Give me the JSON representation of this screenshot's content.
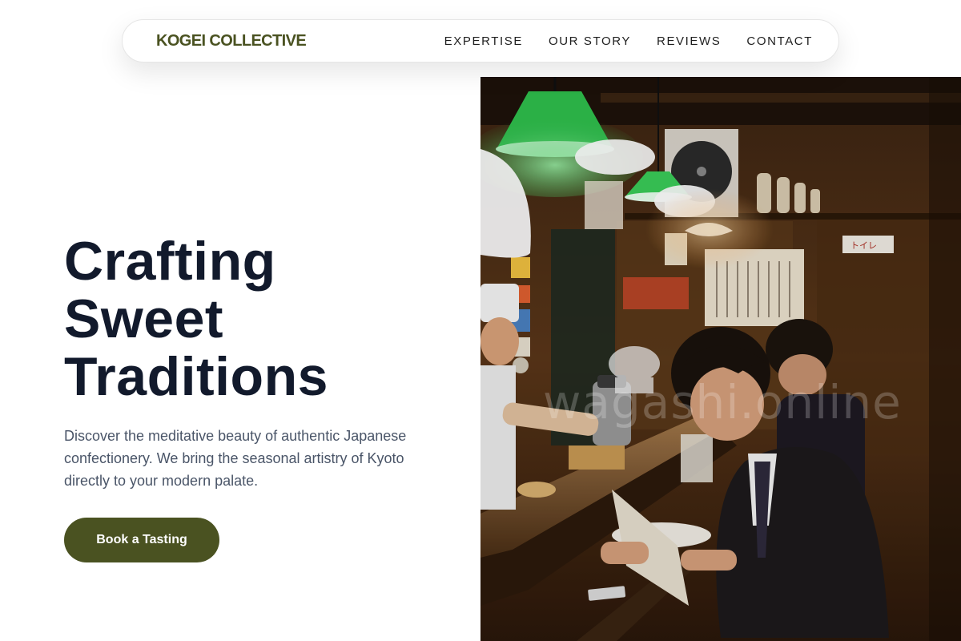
{
  "nav": {
    "brand": "KOGEI COLLECTIVE",
    "links": [
      "EXPERTISE",
      "OUR STORY",
      "REVIEWS",
      "CONTACT"
    ]
  },
  "hero": {
    "title_lines": [
      "Crafting",
      "Sweet",
      "Traditions"
    ],
    "description": "Discover the meditative beauty of authentic Japanese confectionery. We bring the seasonal artistry of Kyoto directly to your modern palate.",
    "cta_label": "Book a Tasting"
  },
  "image": {
    "watermark": "wagashi.online",
    "sign_text": "トイレ"
  },
  "colors": {
    "accent": "#4a5221",
    "heading": "#121a2c",
    "body_text": "#4a5568"
  }
}
